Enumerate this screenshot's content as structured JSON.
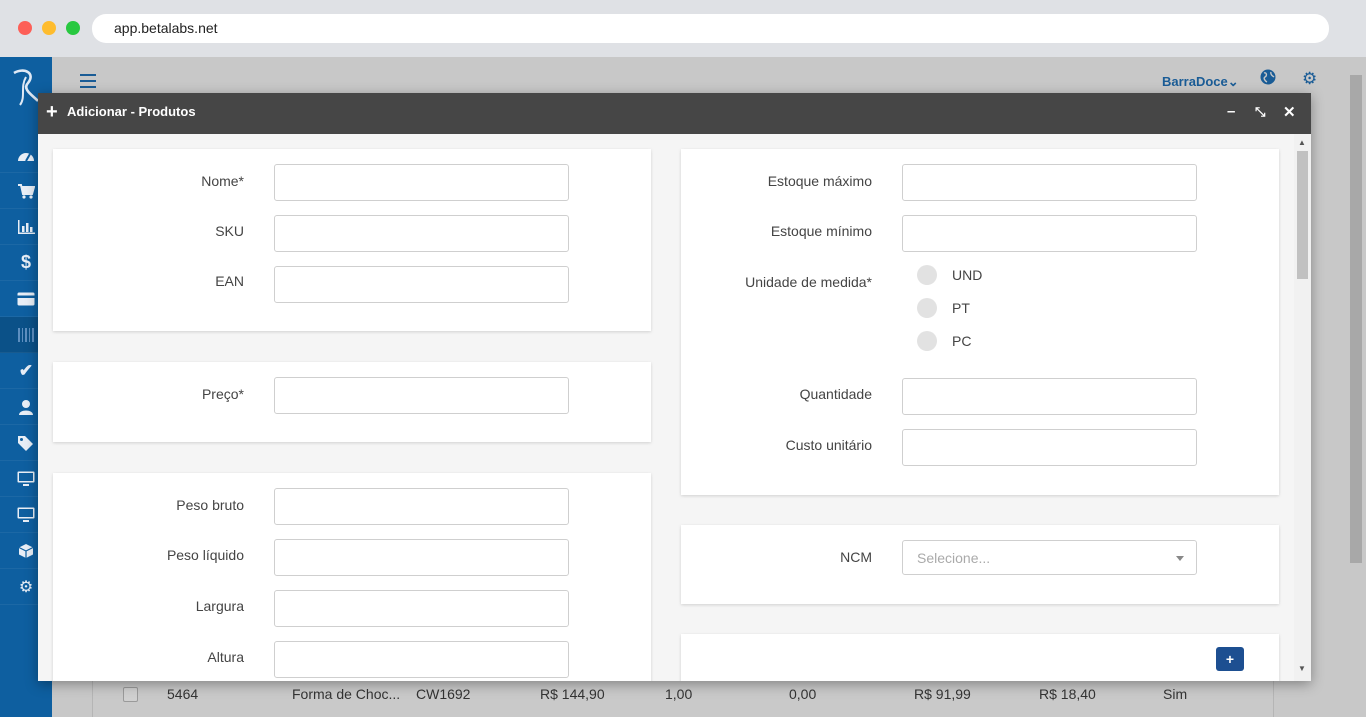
{
  "browser": {
    "url": "app.betalabs.net"
  },
  "topbar": {
    "store_name": "BarraDoce",
    "store_caret": "⌄"
  },
  "background_row": {
    "id": "5464",
    "name": "Forma de Choc...",
    "sku": "CW1692",
    "price": "R$ 144,90",
    "qty": "1,00",
    "val": "0,00",
    "cost": "R$ 91,99",
    "margin": "R$ 18,40",
    "active": "Sim"
  },
  "modal": {
    "title": "Adicionar - Produtos",
    "plus_icon": "+",
    "minimize": "–",
    "restore": "⤡",
    "close": "✕"
  },
  "form": {
    "nome": "Nome*",
    "sku": "SKU",
    "ean": "EAN",
    "preco": "Preço*",
    "peso_bruto": "Peso bruto",
    "peso_liquido": "Peso líquido",
    "largura": "Largura",
    "altura": "Altura",
    "estoque_maximo": "Estoque máximo",
    "estoque_minimo": "Estoque mínimo",
    "unidade_medida": "Unidade de medida*",
    "unidades": [
      "UND",
      "PT",
      "PC"
    ],
    "quantidade": "Quantidade",
    "custo_unitario": "Custo unitário",
    "ncm": "NCM",
    "ncm_placeholder": "Selecione...",
    "add_button": "+"
  },
  "icons": {
    "sidebar": [
      "dashboard-icon",
      "cart-icon",
      "chart-icon",
      "dollar-icon",
      "card-icon",
      "barcode-icon",
      "check-icon",
      "user-icon",
      "tags-icon",
      "monitor-icon",
      "monitor-icon",
      "box-icon",
      "gear-icon"
    ]
  }
}
